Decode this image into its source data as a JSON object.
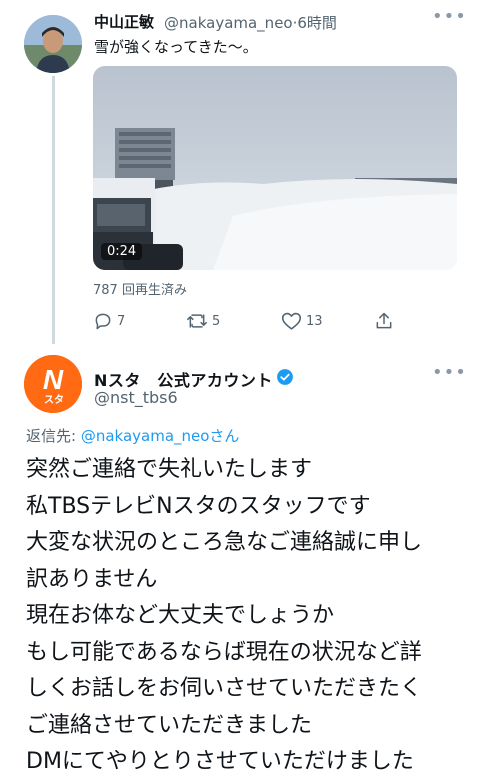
{
  "tweet": {
    "name": "中山正敏",
    "handle": "@nakayama_neo",
    "time": "6時間",
    "text": "雪が強くなってきた〜。",
    "video_duration": "0:24",
    "views": "787 回再生済み",
    "actions": {
      "reply_count": "7",
      "retweet_count": "5",
      "like_count": "13"
    }
  },
  "reply": {
    "avatar_text": "N",
    "avatar_subtext": "スタ",
    "name": "Nスタ　公式アカウント",
    "handle": "@nst_tbs6",
    "replying_label": "返信先: ",
    "replying_to": "@nakayama_neoさん",
    "lines": [
      "突然ご連絡で失礼いたします",
      "私TBSテレビNスタのスタッフです",
      "大変な状況のところ急なご連絡誠に申し",
      "訳ありません",
      "現在お体など大丈夫でしょうか",
      "もし可能であるならば現在の状況など詳",
      "しくお話しをお伺いさせていただきたく",
      "ご連絡させていただきました",
      "DMにてやりとりさせていただけました"
    ]
  },
  "icons": [
    "more-icon",
    "reply-icon",
    "retweet-icon",
    "like-icon",
    "share-icon",
    "verified-badge-icon"
  ],
  "colors": {
    "accent": "#1d9bf0",
    "muted": "#536471",
    "brand_orange": "#ff6a12"
  }
}
